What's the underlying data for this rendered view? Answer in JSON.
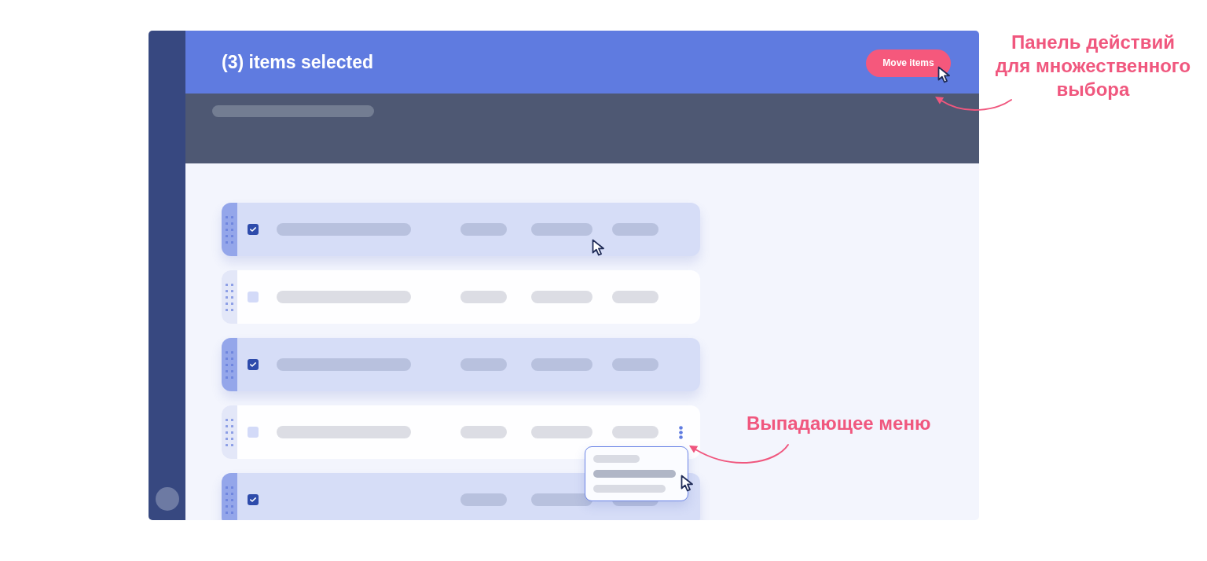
{
  "header": {
    "title": "(3) items selected",
    "move_button": {
      "label": "Move items",
      "hovered": true
    }
  },
  "rows": [
    {
      "selected": true,
      "hovered": true,
      "title_placeholder": true,
      "menu_open": false
    },
    {
      "selected": false,
      "hovered": false,
      "title_placeholder": true,
      "menu_open": false
    },
    {
      "selected": true,
      "hovered": false,
      "title_placeholder": true,
      "menu_open": false
    },
    {
      "selected": false,
      "hovered": false,
      "title_placeholder": true,
      "menu_open": true
    },
    {
      "selected": true,
      "hovered": false,
      "title_placeholder": false,
      "menu_open": false
    }
  ],
  "dropdown": {
    "items": [
      {
        "selected": false
      },
      {
        "selected": true
      },
      {
        "selected": false
      }
    ]
  },
  "annotations": {
    "action_bar": "Панель действий\nдля множественного\nвыбора",
    "dropdown": "Выпадающее меню"
  }
}
